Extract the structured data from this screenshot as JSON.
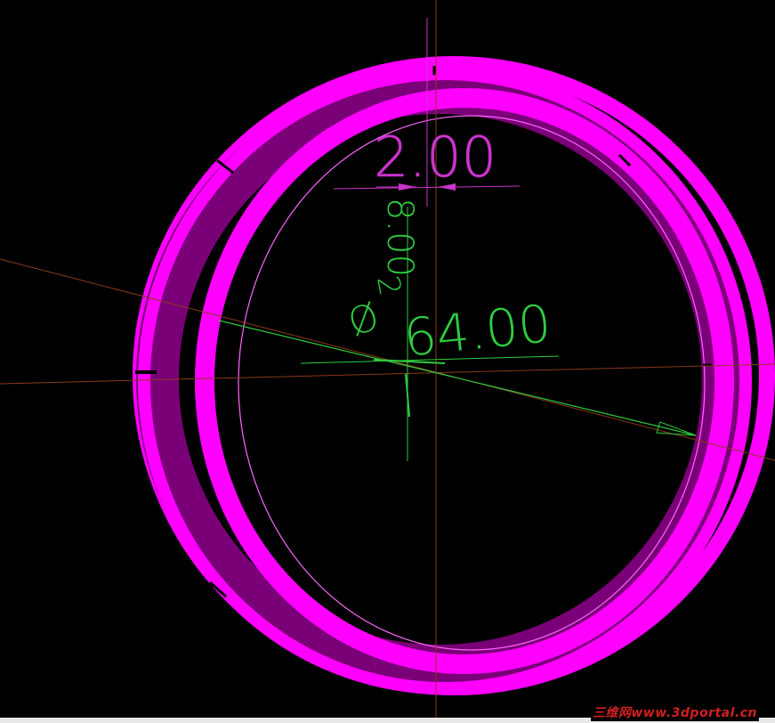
{
  "drawing": {
    "dimensions": {
      "width_label": "2.00",
      "vertical_label": "8.00",
      "diameter_symbol": "Ø",
      "diameter_small_label": "2",
      "diameter_label": "64.00"
    }
  },
  "watermark": "三维网www.3dportal.cn",
  "colors": {
    "background": "#000000",
    "ring_bright": "#ff00ff",
    "ring_dark": "#7a0077",
    "dimension_magenta": "#cc33cc",
    "dimension_green": "#2ecc40",
    "axis_brown": "#8b3a1a"
  }
}
